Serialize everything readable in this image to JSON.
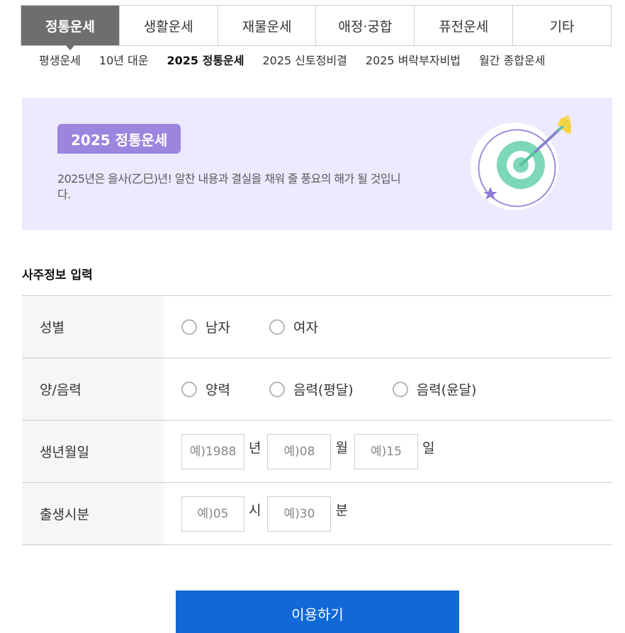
{
  "main_tabs": [
    {
      "label": "정통운세",
      "active": true
    },
    {
      "label": "생활운세"
    },
    {
      "label": "재물운세"
    },
    {
      "label": "애정·궁합"
    },
    {
      "label": "퓨전운세"
    },
    {
      "label": "기타"
    }
  ],
  "sub_tabs": [
    {
      "label": "평생운세"
    },
    {
      "label": "10년 대운"
    },
    {
      "label": "2025 정통운세",
      "active": true
    },
    {
      "label": "2025 신토정비결"
    },
    {
      "label": "2025 벼락부자비법"
    },
    {
      "label": "월간 종합운세"
    }
  ],
  "banner": {
    "badge": "2025 정통운세",
    "description": "2025년은 을사(乙巳)년! 알찬 내용과 결실을 채워 줄 풍요의 해가 될 것입니다.",
    "icon": "target-dart-icon",
    "colors": {
      "background": "#ede9ff",
      "badge": "#9b85de",
      "target": "#7dd8b8",
      "arrow": "#f5d440",
      "star": "#8f78d6"
    }
  },
  "form": {
    "title": "사주정보 입력",
    "gender": {
      "label": "성별",
      "options": [
        "남자",
        "여자"
      ]
    },
    "calendar": {
      "label": "양/음력",
      "options": [
        "양력",
        "음력(평달)",
        "음력(윤달)"
      ]
    },
    "birthdate": {
      "label": "생년월일",
      "year_placeholder": "예)1988",
      "year_unit": "년",
      "month_placeholder": "예)08",
      "month_unit": "월",
      "day_placeholder": "예)15",
      "day_unit": "일"
    },
    "birthtime": {
      "label": "출생시분",
      "hour_placeholder": "예)05",
      "hour_unit": "시",
      "minute_placeholder": "예)30",
      "minute_unit": "분"
    }
  },
  "submit_label": "이용하기",
  "accent_color": "#1169d8"
}
